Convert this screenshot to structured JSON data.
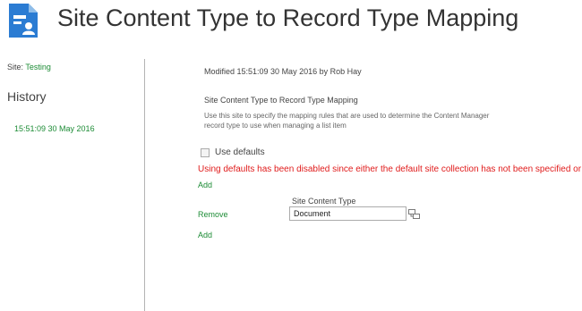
{
  "header": {
    "title": "Site Content Type to Record Type Mapping",
    "logo_icon": "record-mapping-icon",
    "logo_color": "#2b7cd3"
  },
  "sidebar": {
    "site_label": "Site:",
    "site_name": "Testing",
    "history_heading": "History",
    "history_items": [
      "15:51:09 30 May 2016"
    ]
  },
  "main": {
    "modified": "Modified 15:51:09 30 May 2016 by Rob Hay",
    "section_title": "Site Content Type to Record Type Mapping",
    "description": "Use this site to specify the mapping rules that are used to determine the Content Manager record type to use when managing a list item",
    "use_defaults_label": "Use defaults",
    "use_defaults_checked": false,
    "error_message": "Using defaults has been disabled since either the default site collection has not been specified or def",
    "add_label": "Add",
    "remove_label": "Remove",
    "content_type_label": "Site Content Type",
    "content_type_value": "Document",
    "browse_icon": "browse-lookup-icon"
  },
  "colors": {
    "link_green": "#1d8c36",
    "error_red": "#e01b1b",
    "divider": "#b3b3b3"
  }
}
